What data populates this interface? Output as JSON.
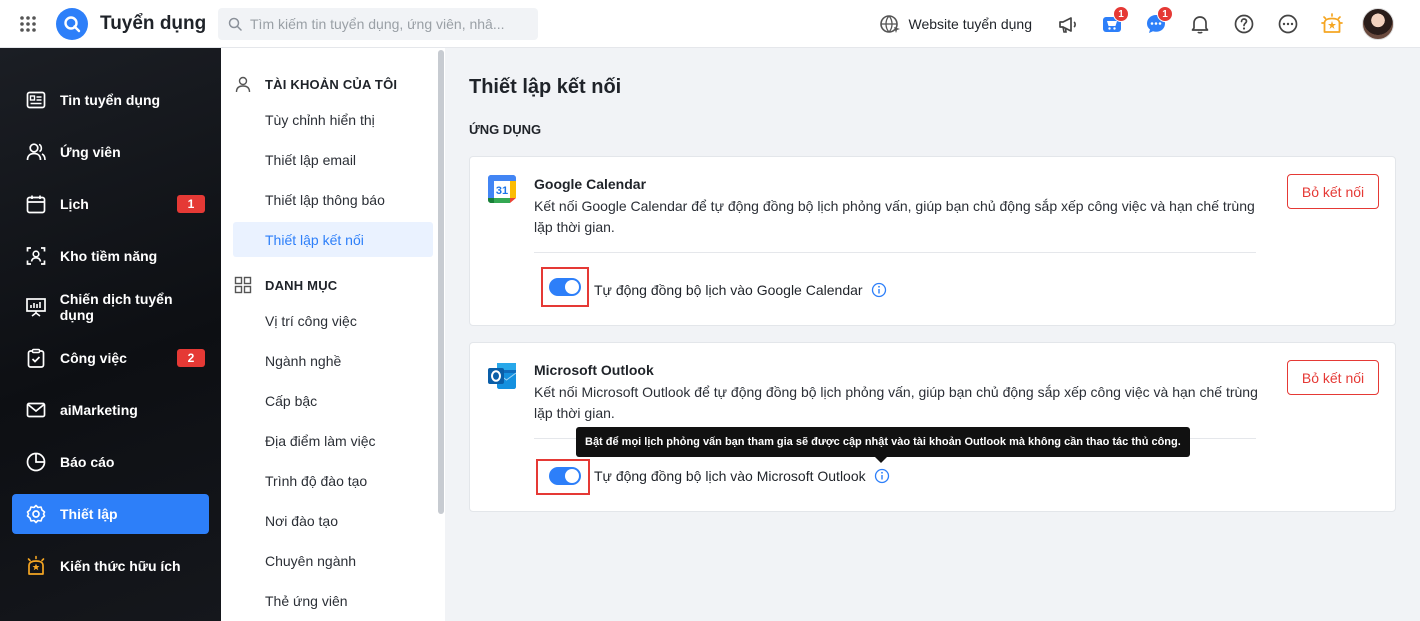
{
  "header": {
    "app_title": "Tuyển dụng",
    "search_placeholder": "Tìm kiếm tin tuyển dụng, ứng viên, nhâ...",
    "website_link": "Website tuyển dụng",
    "cart_badge": "1",
    "chat_badge": "1"
  },
  "leftnav": {
    "items": [
      {
        "label": "Tin tuyển dụng",
        "icon": "job-post-icon"
      },
      {
        "label": "Ứng viên",
        "icon": "candidates-icon"
      },
      {
        "label": "Lịch",
        "icon": "calendar-icon",
        "badge": "1"
      },
      {
        "label": "Kho tiềm năng",
        "icon": "talent-pool-icon"
      },
      {
        "label": "Chiến dịch tuyển dụng",
        "icon": "campaign-icon"
      },
      {
        "label": "Công việc",
        "icon": "task-icon",
        "badge": "2"
      },
      {
        "label": "aiMarketing",
        "icon": "mail-icon"
      },
      {
        "label": "Báo cáo",
        "icon": "report-icon"
      },
      {
        "label": "Thiết lập",
        "icon": "gear-icon",
        "active": true
      },
      {
        "label": "Kiến thức hữu ích",
        "icon": "lightbulb-icon"
      }
    ]
  },
  "subnav": {
    "account_heading": "TÀI KHOẢN CỦA TÔI",
    "account_items": [
      "Tùy chỉnh hiển thị",
      "Thiết lập email",
      "Thiết lập thông báo",
      "Thiết lập kết nối"
    ],
    "catalog_heading": "DANH MỤC",
    "catalog_items": [
      "Vị trí công việc",
      "Ngành nghề",
      "Cấp bậc",
      "Địa điểm làm việc",
      "Trình độ đào tạo",
      "Nơi đào tạo",
      "Chuyên ngành",
      "Thẻ ứng viên"
    ]
  },
  "main": {
    "title": "Thiết lập kết nối",
    "section": "ỨNG DỤNG",
    "apps": [
      {
        "name": "Google Calendar",
        "description": "Kết nối Google Calendar để tự động đồng bộ lịch phỏng vấn, giúp bạn chủ động sắp xếp công việc và hạn chế trùng lặp thời gian.",
        "button": "Bỏ kết nối",
        "sync_label": "Tự động đồng bộ lịch vào Google Calendar",
        "sync_on": true
      },
      {
        "name": "Microsoft Outlook",
        "description": "Kết nối Microsoft Outlook để tự động đồng bộ lịch phỏng vấn, giúp bạn chủ động sắp xếp công việc và hạn chế trùng lặp thời gian.",
        "button": "Bỏ kết nối",
        "sync_label": "Tự động đồng bộ lịch vào Microsoft Outlook",
        "sync_on": true
      }
    ],
    "tooltip": "Bật để mọi lịch phỏng vấn bạn tham gia sẽ được cập nhật vào tài khoản Outlook mà không cần thao tác thủ công."
  },
  "colors": {
    "accent": "#2d7ff9",
    "danger": "#e53935",
    "sidebar_bg": "#111318"
  }
}
